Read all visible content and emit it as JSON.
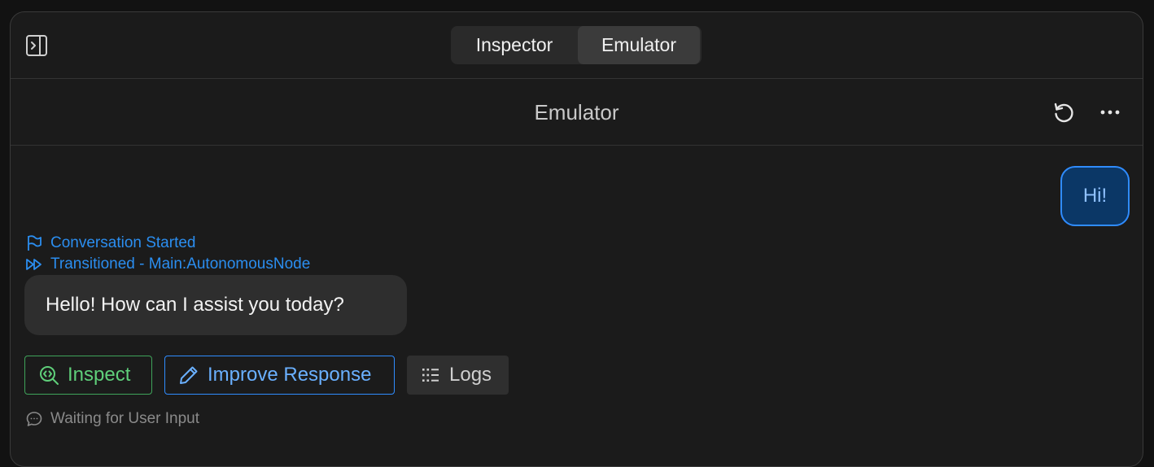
{
  "tabs": [
    {
      "label": "Inspector",
      "selected": false
    },
    {
      "label": "Emulator",
      "selected": true
    }
  ],
  "header": {
    "title": "Emulator",
    "icons": [
      "reset-icon",
      "more-icon"
    ]
  },
  "messages": {
    "user": "Hi!",
    "bot": "Hello! How can I assist you today?"
  },
  "events": [
    {
      "icon": "flag-icon",
      "label": "Conversation Started"
    },
    {
      "icon": "fast-forward-icon",
      "label": "Transitioned - Main:AutonomousNode"
    }
  ],
  "actions": {
    "inspect_label": "Inspect",
    "improve_label": "Improve Response",
    "logs_label": "Logs"
  },
  "status": {
    "icon": "chat-bubble-icon",
    "label": "Waiting for User Input"
  },
  "colors": {
    "accent_blue": "#2f8cff",
    "accent_green": "#3fa35a",
    "background": "#1b1b1b"
  }
}
